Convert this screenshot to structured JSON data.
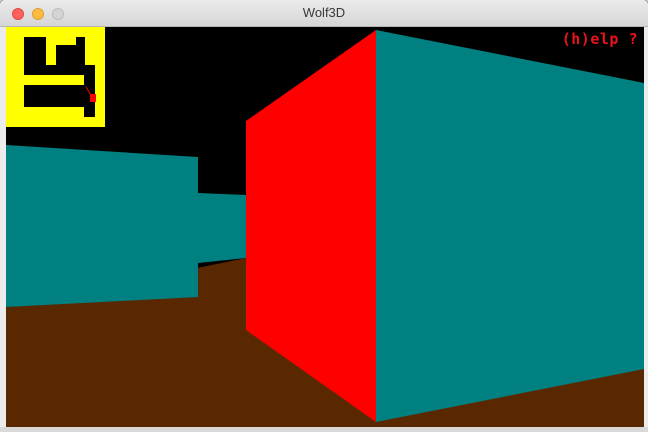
{
  "window": {
    "title": "Wolf3D"
  },
  "game": {
    "help_label": "(h)elp ?",
    "colors": {
      "sky": "#000000",
      "floor": "#5a2800",
      "wall_teal": "#008080",
      "wall_red": "#ff0000",
      "minimap_wall": "#ffff00",
      "player": "#ff0000"
    }
  }
}
